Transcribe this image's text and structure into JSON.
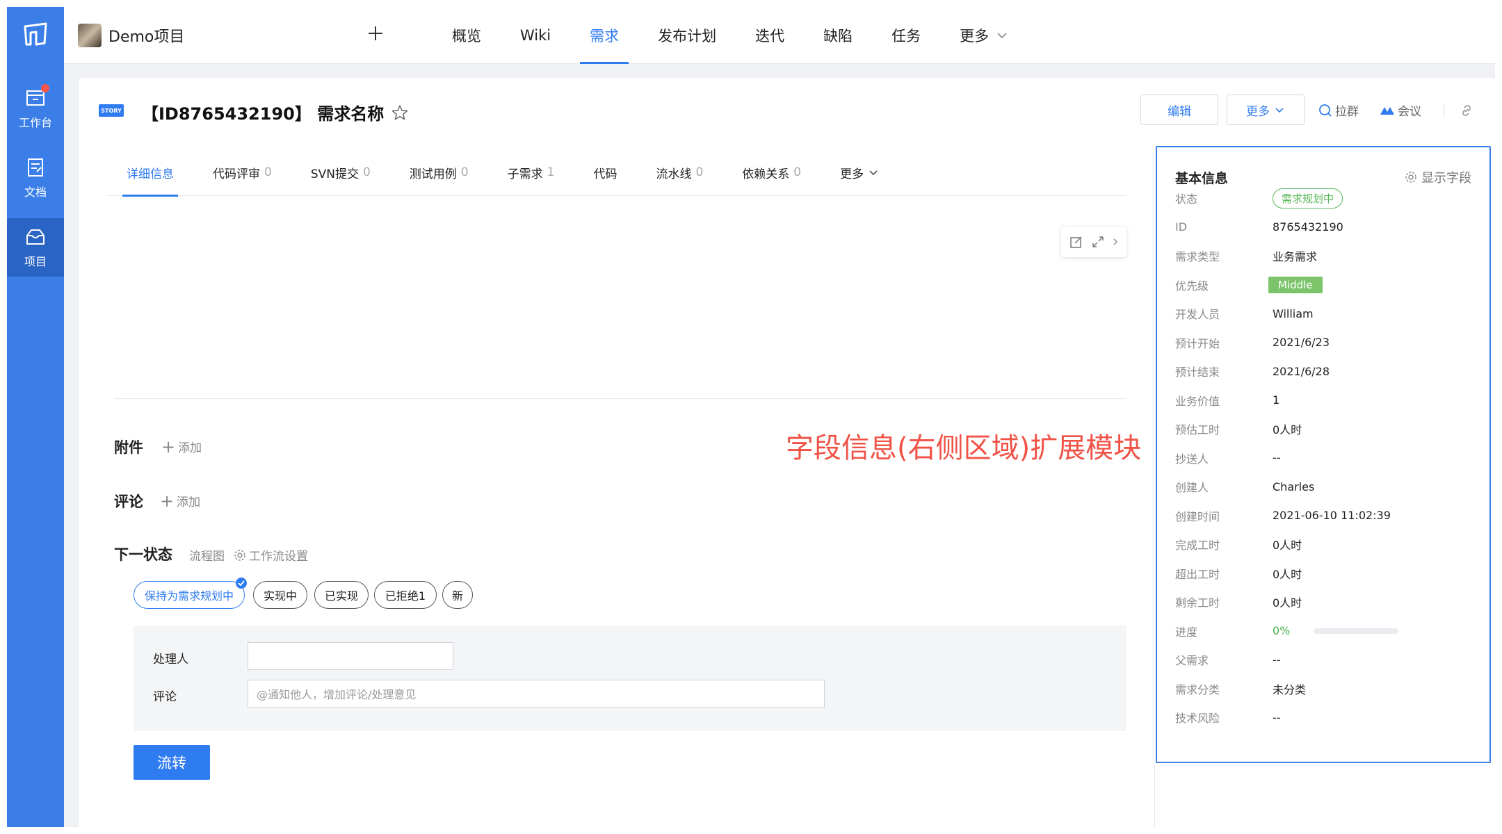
{
  "colors": {
    "primary": "#2f7cf0",
    "rail": "#3b7ee8",
    "annotation": "#f05246",
    "success": "#5cb85c"
  },
  "rail": {
    "items": [
      {
        "label": "工作台",
        "icon": "inbox-icon"
      },
      {
        "label": "文档",
        "icon": "document-icon"
      },
      {
        "label": "项目",
        "icon": "project-icon"
      }
    ]
  },
  "topbar": {
    "project_name": "Demo项目",
    "tabs": [
      "概览",
      "Wiki",
      "需求",
      "发布计划",
      "迭代",
      "缺陷",
      "任务",
      "更多"
    ],
    "active_tab": "需求"
  },
  "story": {
    "badge": "STORY",
    "title": "【ID8765432190】 需求名称",
    "actions": {
      "edit": "编辑",
      "more": "更多",
      "group": "拉群",
      "meeting": "会议"
    }
  },
  "subtabs": [
    {
      "label": "详细信息",
      "count": ""
    },
    {
      "label": "代码评审",
      "count": "0"
    },
    {
      "label": "SVN提交",
      "count": "0"
    },
    {
      "label": "测试用例",
      "count": "0"
    },
    {
      "label": "子需求",
      "count": "1"
    },
    {
      "label": "代码",
      "count": ""
    },
    {
      "label": "流水线",
      "count": "0"
    },
    {
      "label": "依赖关系",
      "count": "0"
    },
    {
      "label": "更多",
      "count": ""
    }
  ],
  "sections": {
    "attachment": "附件",
    "comment": "评论",
    "add": "添加",
    "next_state": "下一状态",
    "flowchart": "流程图",
    "workflow_settings": "工作流设置"
  },
  "annotation": "字段信息(右侧区域)扩展模块",
  "states": [
    "保持为需求规划中",
    "实现中",
    "已实现",
    "已拒绝1",
    "新"
  ],
  "form": {
    "assignee_label": "处理人",
    "comment_label": "评论",
    "comment_placeholder": "@通知他人，增加评论/处理意见",
    "submit": "流转"
  },
  "panel": {
    "title": "基本信息",
    "show_fields": "显示字段",
    "rows": [
      {
        "key": "状态",
        "value": "需求规划中"
      },
      {
        "key": "ID",
        "value": "8765432190"
      },
      {
        "key": "需求类型",
        "value": "业务需求"
      },
      {
        "key": "优先级",
        "value": "Middle"
      },
      {
        "key": "开发人员",
        "value": "William"
      },
      {
        "key": "预计开始",
        "value": "2021/6/23"
      },
      {
        "key": "预计结束",
        "value": "2021/6/28"
      },
      {
        "key": "业务价值",
        "value": "1"
      },
      {
        "key": "预估工时",
        "value": "0人时"
      },
      {
        "key": "抄送人",
        "value": "--"
      },
      {
        "key": "创建人",
        "value": "Charles"
      },
      {
        "key": "创建时间",
        "value": "2021-06-10 11:02:39"
      },
      {
        "key": "完成工时",
        "value": "0人时"
      },
      {
        "key": "超出工时",
        "value": "0人时"
      },
      {
        "key": "剩余工时",
        "value": "0人时"
      },
      {
        "key": "进度",
        "value": "0%"
      },
      {
        "key": "父需求",
        "value": "--"
      },
      {
        "key": "需求分类",
        "value": "未分类"
      },
      {
        "key": "技术风险",
        "value": "--"
      }
    ],
    "progress_fraction": 0
  }
}
